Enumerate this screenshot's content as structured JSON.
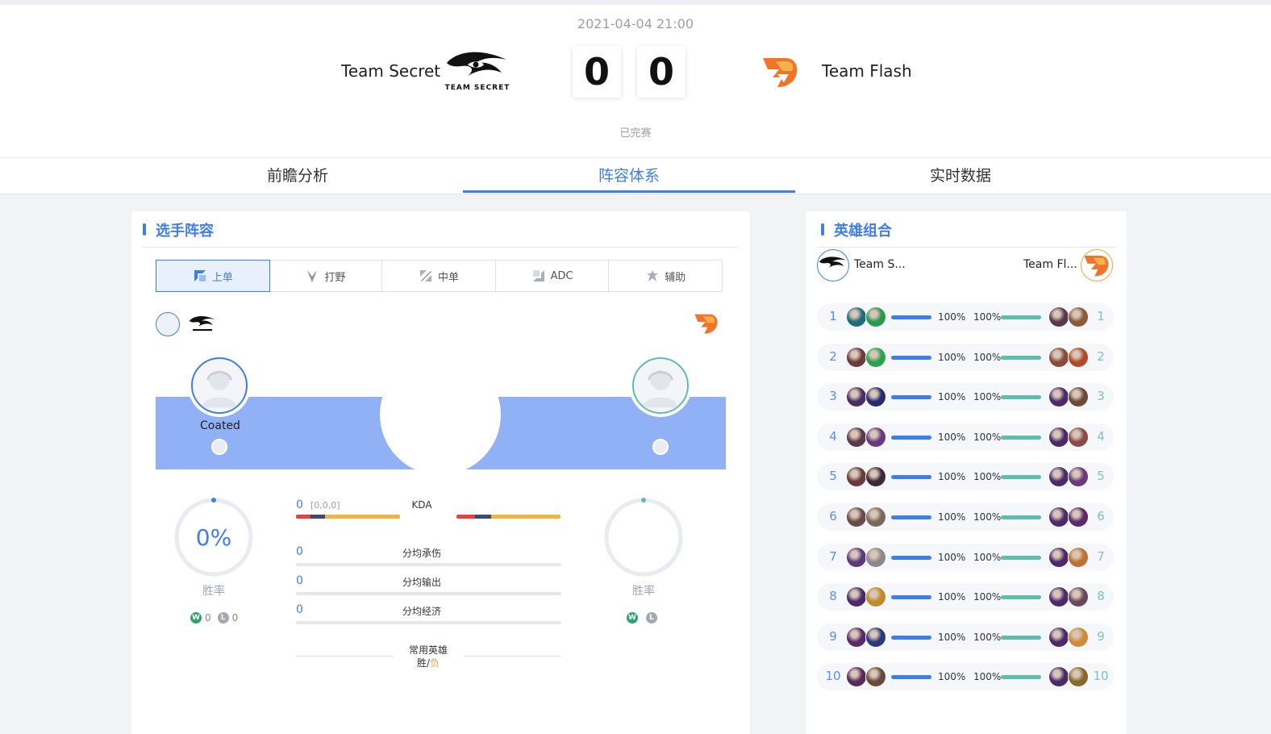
{
  "match": {
    "datetime": "2021-04-04 21:00",
    "status": "已完赛",
    "home": {
      "name": "Team Secret",
      "score": "0",
      "logo_text": "TEAM SECRET"
    },
    "away": {
      "name": "Team Flash",
      "score": "0"
    }
  },
  "tabs": [
    {
      "label": "前瞻分析"
    },
    {
      "label": "阵容体系",
      "active": true
    },
    {
      "label": "实时数据"
    }
  ],
  "lineup": {
    "title": "选手阵容",
    "roles": [
      {
        "label": "上单",
        "icon": "top-lane-icon",
        "active": true
      },
      {
        "label": "打野",
        "icon": "jungle-icon"
      },
      {
        "label": "中单",
        "icon": "mid-lane-icon"
      },
      {
        "label": "ADC",
        "icon": "adc-icon"
      },
      {
        "label": "辅助",
        "icon": "support-icon"
      }
    ],
    "home_player": "Coated",
    "home_winrate": "0%",
    "winrate_label": "胜率",
    "home_wins": "0",
    "home_losses": "0",
    "kda_value": "0",
    "kda_detail": "[0,0,0]",
    "kda_label": "KDA",
    "damage_taken_value": "0",
    "damage_taken_label": "分均承伤",
    "damage_dealt_value": "0",
    "damage_dealt_label": "分均输出",
    "economy_value": "0",
    "economy_label": "分均经济",
    "common_heroes_label": "常用英雄",
    "win_loss_label_win": "胜/",
    "win_loss_label_loss": "负",
    "colors": {
      "primary": "#3f7ee8",
      "secondary": "#5fbdaf",
      "kda_red": "#e8413e",
      "kda_navy": "#3d4a78",
      "kda_orange": "#f3b43b"
    }
  },
  "combos": {
    "title": "英雄组合",
    "home_name": "Team S...",
    "away_name": "Team Fl...",
    "rows": [
      {
        "idx": "1",
        "home_pct": "100%",
        "away_pct": "100%"
      },
      {
        "idx": "2",
        "home_pct": "100%",
        "away_pct": "100%"
      },
      {
        "idx": "3",
        "home_pct": "100%",
        "away_pct": "100%"
      },
      {
        "idx": "4",
        "home_pct": "100%",
        "away_pct": "100%"
      },
      {
        "idx": "5",
        "home_pct": "100%",
        "away_pct": "100%"
      },
      {
        "idx": "6",
        "home_pct": "100%",
        "away_pct": "100%"
      },
      {
        "idx": "7",
        "home_pct": "100%",
        "away_pct": "100%"
      },
      {
        "idx": "8",
        "home_pct": "100%",
        "away_pct": "100%"
      },
      {
        "idx": "9",
        "home_pct": "100%",
        "away_pct": "100%"
      },
      {
        "idx": "10",
        "home_pct": "100%",
        "away_pct": "100%"
      }
    ]
  }
}
